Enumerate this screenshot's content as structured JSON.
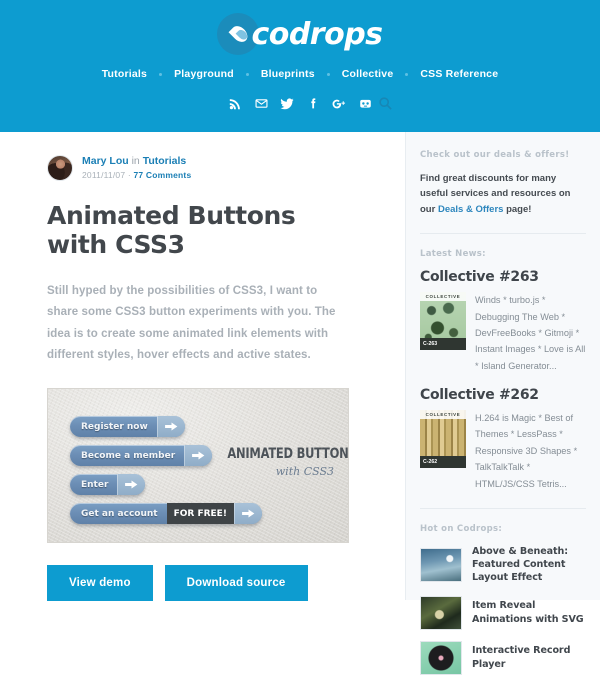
{
  "header": {
    "logo_text": "codrops",
    "logo_icon": "water-drop-icon",
    "nav": [
      {
        "label": "Tutorials"
      },
      {
        "label": "Playground"
      },
      {
        "label": "Blueprints"
      },
      {
        "label": "Collective"
      },
      {
        "label": "CSS Reference"
      }
    ],
    "social": [
      {
        "name": "rss-icon"
      },
      {
        "name": "email-icon"
      },
      {
        "name": "twitter-icon"
      },
      {
        "name": "facebook-icon"
      },
      {
        "name": "googleplus-icon"
      },
      {
        "name": "github-icon"
      }
    ],
    "search_icon": "search-icon",
    "bg_color": "#0d9cd0"
  },
  "article": {
    "author": "Mary Lou",
    "in_word": " in ",
    "category": "Tutorials",
    "date": "2011/11/07",
    "separator": " · ",
    "comments": "77 Comments",
    "title": "Animated Buttons with CSS3",
    "intro": "Still hyped by the possibilities of CSS3, I want to share some CSS3 button experiments with you. The idea is to create some animated link elements with different styles, hover effects and active states.",
    "featured_image": {
      "alt": "Animated Buttons with CSS3 preview",
      "buttons": [
        {
          "label": "Register now",
          "arrow": "arrow-right-icon"
        },
        {
          "label": "Become a member",
          "arrow": "arrow-right-icon"
        },
        {
          "label": "Enter",
          "arrow": "arrow-right-icon"
        },
        {
          "label": "Get an account",
          "badge": "FOR FREE!",
          "arrow": "arrow-right-icon"
        }
      ],
      "title": "ANIMATED BUTTONS",
      "subtitle": "with CSS3"
    },
    "actions": [
      {
        "label": "View demo"
      },
      {
        "label": "Download source"
      }
    ]
  },
  "sidebar": {
    "deals_heading": "Check out our deals & offers!",
    "deals_text_1": "Find great discounts for many useful services and resources on our ",
    "deals_link": "Deals & Offers",
    "deals_text_2": " page!",
    "latest_news_heading": "Latest News:",
    "collectives": [
      {
        "title": "Collective #263",
        "thumb_caption": "COLLECTIVE",
        "thumb_number": "C-263",
        "excerpt": "Winds * turbo.js * Debugging The Web * DevFreeBooks * Gitmoji * Instant Images * Love is All * Island Generator..."
      },
      {
        "title": "Collective #262",
        "thumb_caption": "COLLECTIVE",
        "thumb_number": "C-262",
        "excerpt": "H.264 is Magic * Best of Themes * LessPass * Responsive 3D Shapes * TalkTalkTalk * HTML/JS/CSS Tetris..."
      }
    ],
    "hot_heading": "Hot on Codrops:",
    "hot_items": [
      {
        "title": "Above & Beneath: Featured Content Layout Effect"
      },
      {
        "title": "Item Reveal Animations with SVG"
      },
      {
        "title": "Interactive Record Player"
      }
    ]
  }
}
